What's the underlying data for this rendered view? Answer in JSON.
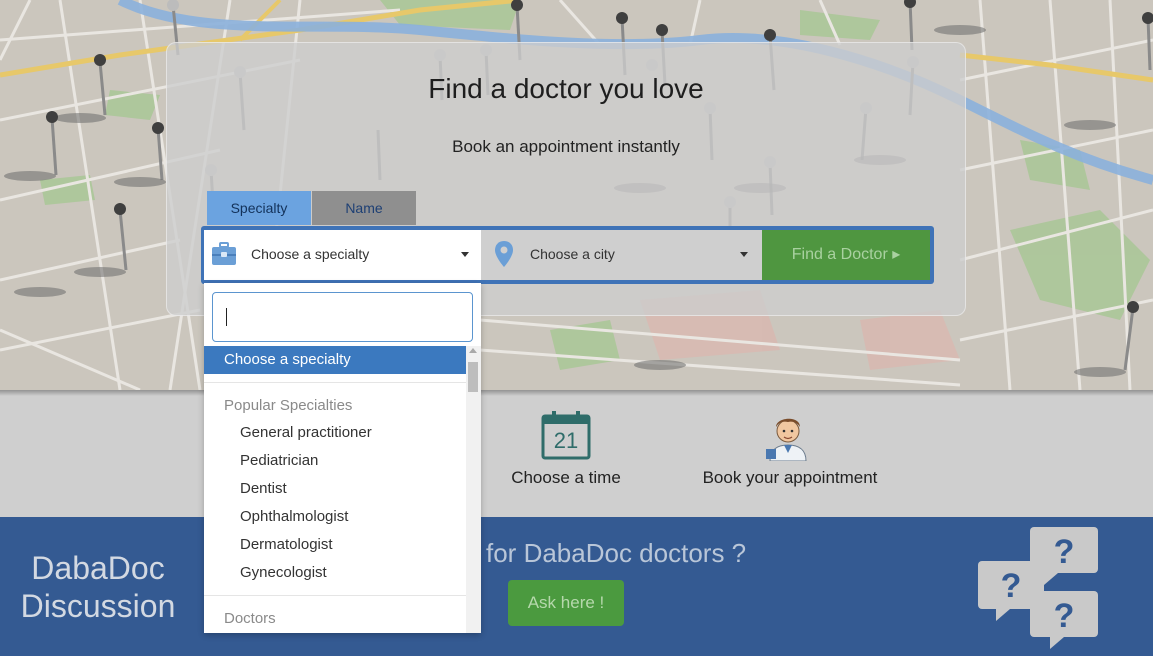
{
  "hero": {
    "title": "Find a doctor you love",
    "subtitle": "Book an appointment instantly"
  },
  "search": {
    "tabs": [
      {
        "label": "Specialty",
        "active": true
      },
      {
        "label": "Name",
        "active": false
      }
    ],
    "specialty_placeholder": "Choose a specialty",
    "city_placeholder": "Choose a city",
    "find_button": "Find a Doctor ▸",
    "specialty_icon": "briefcase-icon",
    "city_icon": "map-pin-icon"
  },
  "dropdown": {
    "search_value": "",
    "selected": "Choose a specialty",
    "groups": [
      {
        "label": "Popular Specialties",
        "items": [
          "General practitioner",
          "Pediatrician",
          "Dentist",
          "Ophthalmologist",
          "Dermatologist",
          "Gynecologist"
        ]
      },
      {
        "label": "Doctors",
        "items": []
      }
    ]
  },
  "steps": [
    {
      "label": "Choose a time",
      "icon": "calendar-icon",
      "calendar_day": "21"
    },
    {
      "label": "Book your appointment",
      "icon": "doctor-icon"
    }
  ],
  "discussion": {
    "title": "DabaDoc Discussion",
    "question_text": "for DabaDoc doctors ?",
    "ask_button": "Ask here !",
    "icon": "question-bubbles-icon"
  },
  "colors": {
    "brand_blue": "#3f73b7",
    "tab_active": "#6ba3e0",
    "find_green": "#4f9640",
    "discussion_blue": "#345a92",
    "dropdown_selected": "#3b79bf"
  }
}
